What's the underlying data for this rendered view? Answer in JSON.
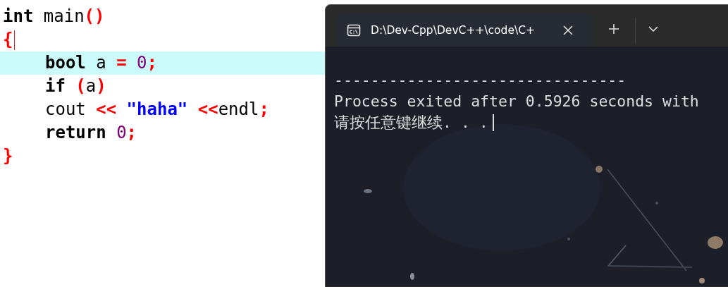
{
  "editor": {
    "lines": [
      {
        "indented": false,
        "current": false,
        "caret": false,
        "tokens": [
          {
            "text": "int",
            "kind": "keyword"
          },
          {
            "text": " main",
            "kind": "ident"
          },
          {
            "text": "()",
            "kind": "punct"
          }
        ]
      },
      {
        "indented": false,
        "current": false,
        "caret": true,
        "tokens": [
          {
            "text": "{",
            "kind": "punct"
          }
        ]
      },
      {
        "indented": true,
        "current": true,
        "caret": false,
        "tokens": [
          {
            "text": "bool",
            "kind": "keyword"
          },
          {
            "text": " a ",
            "kind": "ident"
          },
          {
            "text": "=",
            "kind": "punct"
          },
          {
            "text": " 0",
            "kind": "number"
          },
          {
            "text": ";",
            "kind": "punct"
          }
        ]
      },
      {
        "indented": true,
        "current": false,
        "caret": false,
        "tokens": [
          {
            "text": "if",
            "kind": "keyword"
          },
          {
            "text": " (",
            "kind": "punct"
          },
          {
            "text": "a",
            "kind": "ident"
          },
          {
            "text": ")",
            "kind": "punct"
          }
        ]
      },
      {
        "indented": true,
        "current": false,
        "caret": false,
        "tokens": [
          {
            "text": "cout ",
            "kind": "ident"
          },
          {
            "text": "<< ",
            "kind": "punct"
          },
          {
            "text": "\"haha\"",
            "kind": "string"
          },
          {
            "text": " <<",
            "kind": "punct"
          },
          {
            "text": "endl",
            "kind": "ident"
          },
          {
            "text": ";",
            "kind": "punct"
          }
        ]
      },
      {
        "indented": true,
        "current": false,
        "caret": false,
        "tokens": [
          {
            "text": "return",
            "kind": "keyword"
          },
          {
            "text": " 0",
            "kind": "number"
          },
          {
            "text": ";",
            "kind": "punct"
          }
        ]
      },
      {
        "indented": false,
        "current": false,
        "caret": false,
        "tokens": [
          {
            "text": "}",
            "kind": "punct"
          }
        ]
      }
    ]
  },
  "terminal": {
    "tabs": [
      {
        "title": "D:\\Dev-Cpp\\DevC++\\code\\C+",
        "selected": true
      }
    ],
    "output": [
      {
        "text": "--------------------------------",
        "cursor": false
      },
      {
        "text": "Process exited after 0.5926 seconds with",
        "cursor": false
      },
      {
        "text": "请按任意键继续. . .",
        "cursor": true
      }
    ]
  }
}
